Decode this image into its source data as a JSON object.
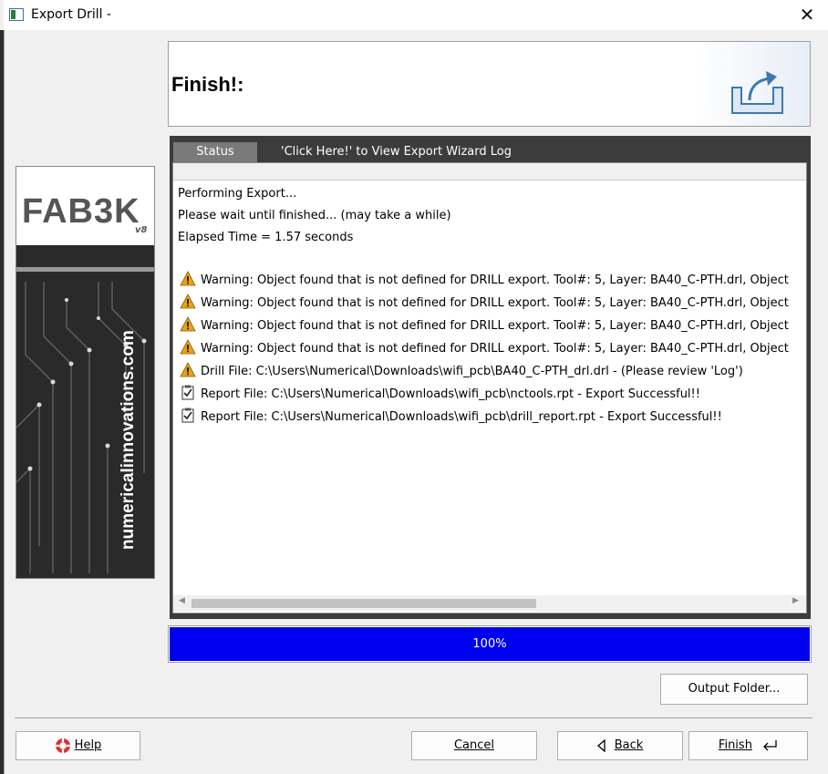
{
  "window": {
    "title": "Export Drill -",
    "close_glyph": "✕"
  },
  "header": {
    "title": "Finish!:",
    "icon": "export-icon"
  },
  "banner": {
    "logo_text": "FAB3K",
    "version": "v8",
    "url": "numericalinnovations.com"
  },
  "tabs": [
    {
      "label": "Status",
      "active": true
    },
    {
      "label": "'Click Here!'  to View Export Wizard Log",
      "active": false
    }
  ],
  "log": {
    "plain": [
      "Performing Export...",
      "Please wait until finished... (may take a while)",
      "Elapsed Time = 1.57 seconds"
    ],
    "entries": [
      {
        "icon": "warning-icon",
        "text": "Warning: Object found that is not defined for DRILL export. Tool#: 5, Layer: BA40_C-PTH.drl, Object"
      },
      {
        "icon": "warning-icon",
        "text": "Warning: Object found that is not defined for DRILL export. Tool#: 5, Layer: BA40_C-PTH.drl, Object"
      },
      {
        "icon": "warning-icon",
        "text": "Warning: Object found that is not defined for DRILL export. Tool#: 5, Layer: BA40_C-PTH.drl, Object"
      },
      {
        "icon": "warning-icon",
        "text": "Warning: Object found that is not defined for DRILL export. Tool#: 5, Layer: BA40_C-PTH.drl, Object"
      },
      {
        "icon": "warning-icon",
        "text": "Drill File: C:\\Users\\Numerical\\Downloads\\wifi_pcb\\BA40_C-PTH_drl.drl  - (Please review 'Log')"
      },
      {
        "icon": "checklist-icon",
        "text": "Report File: C:\\Users\\Numerical\\Downloads\\wifi_pcb\\nctools.rpt  - Export Successful!!"
      },
      {
        "icon": "checklist-icon",
        "text": "Report File: C:\\Users\\Numerical\\Downloads\\wifi_pcb\\drill_report.rpt  - Export Successful!!"
      }
    ]
  },
  "progress": {
    "value": 1.0,
    "label": "100%",
    "color": "#0000f0"
  },
  "buttons": {
    "output_folder": "Output Folder...",
    "help": "Help",
    "cancel": "Cancel",
    "back": "Back",
    "finish": "Finish"
  },
  "colors": {
    "warning": "#e8a317",
    "progress_fill": "#0000f0",
    "tab_bg": "#3c3c3c"
  }
}
